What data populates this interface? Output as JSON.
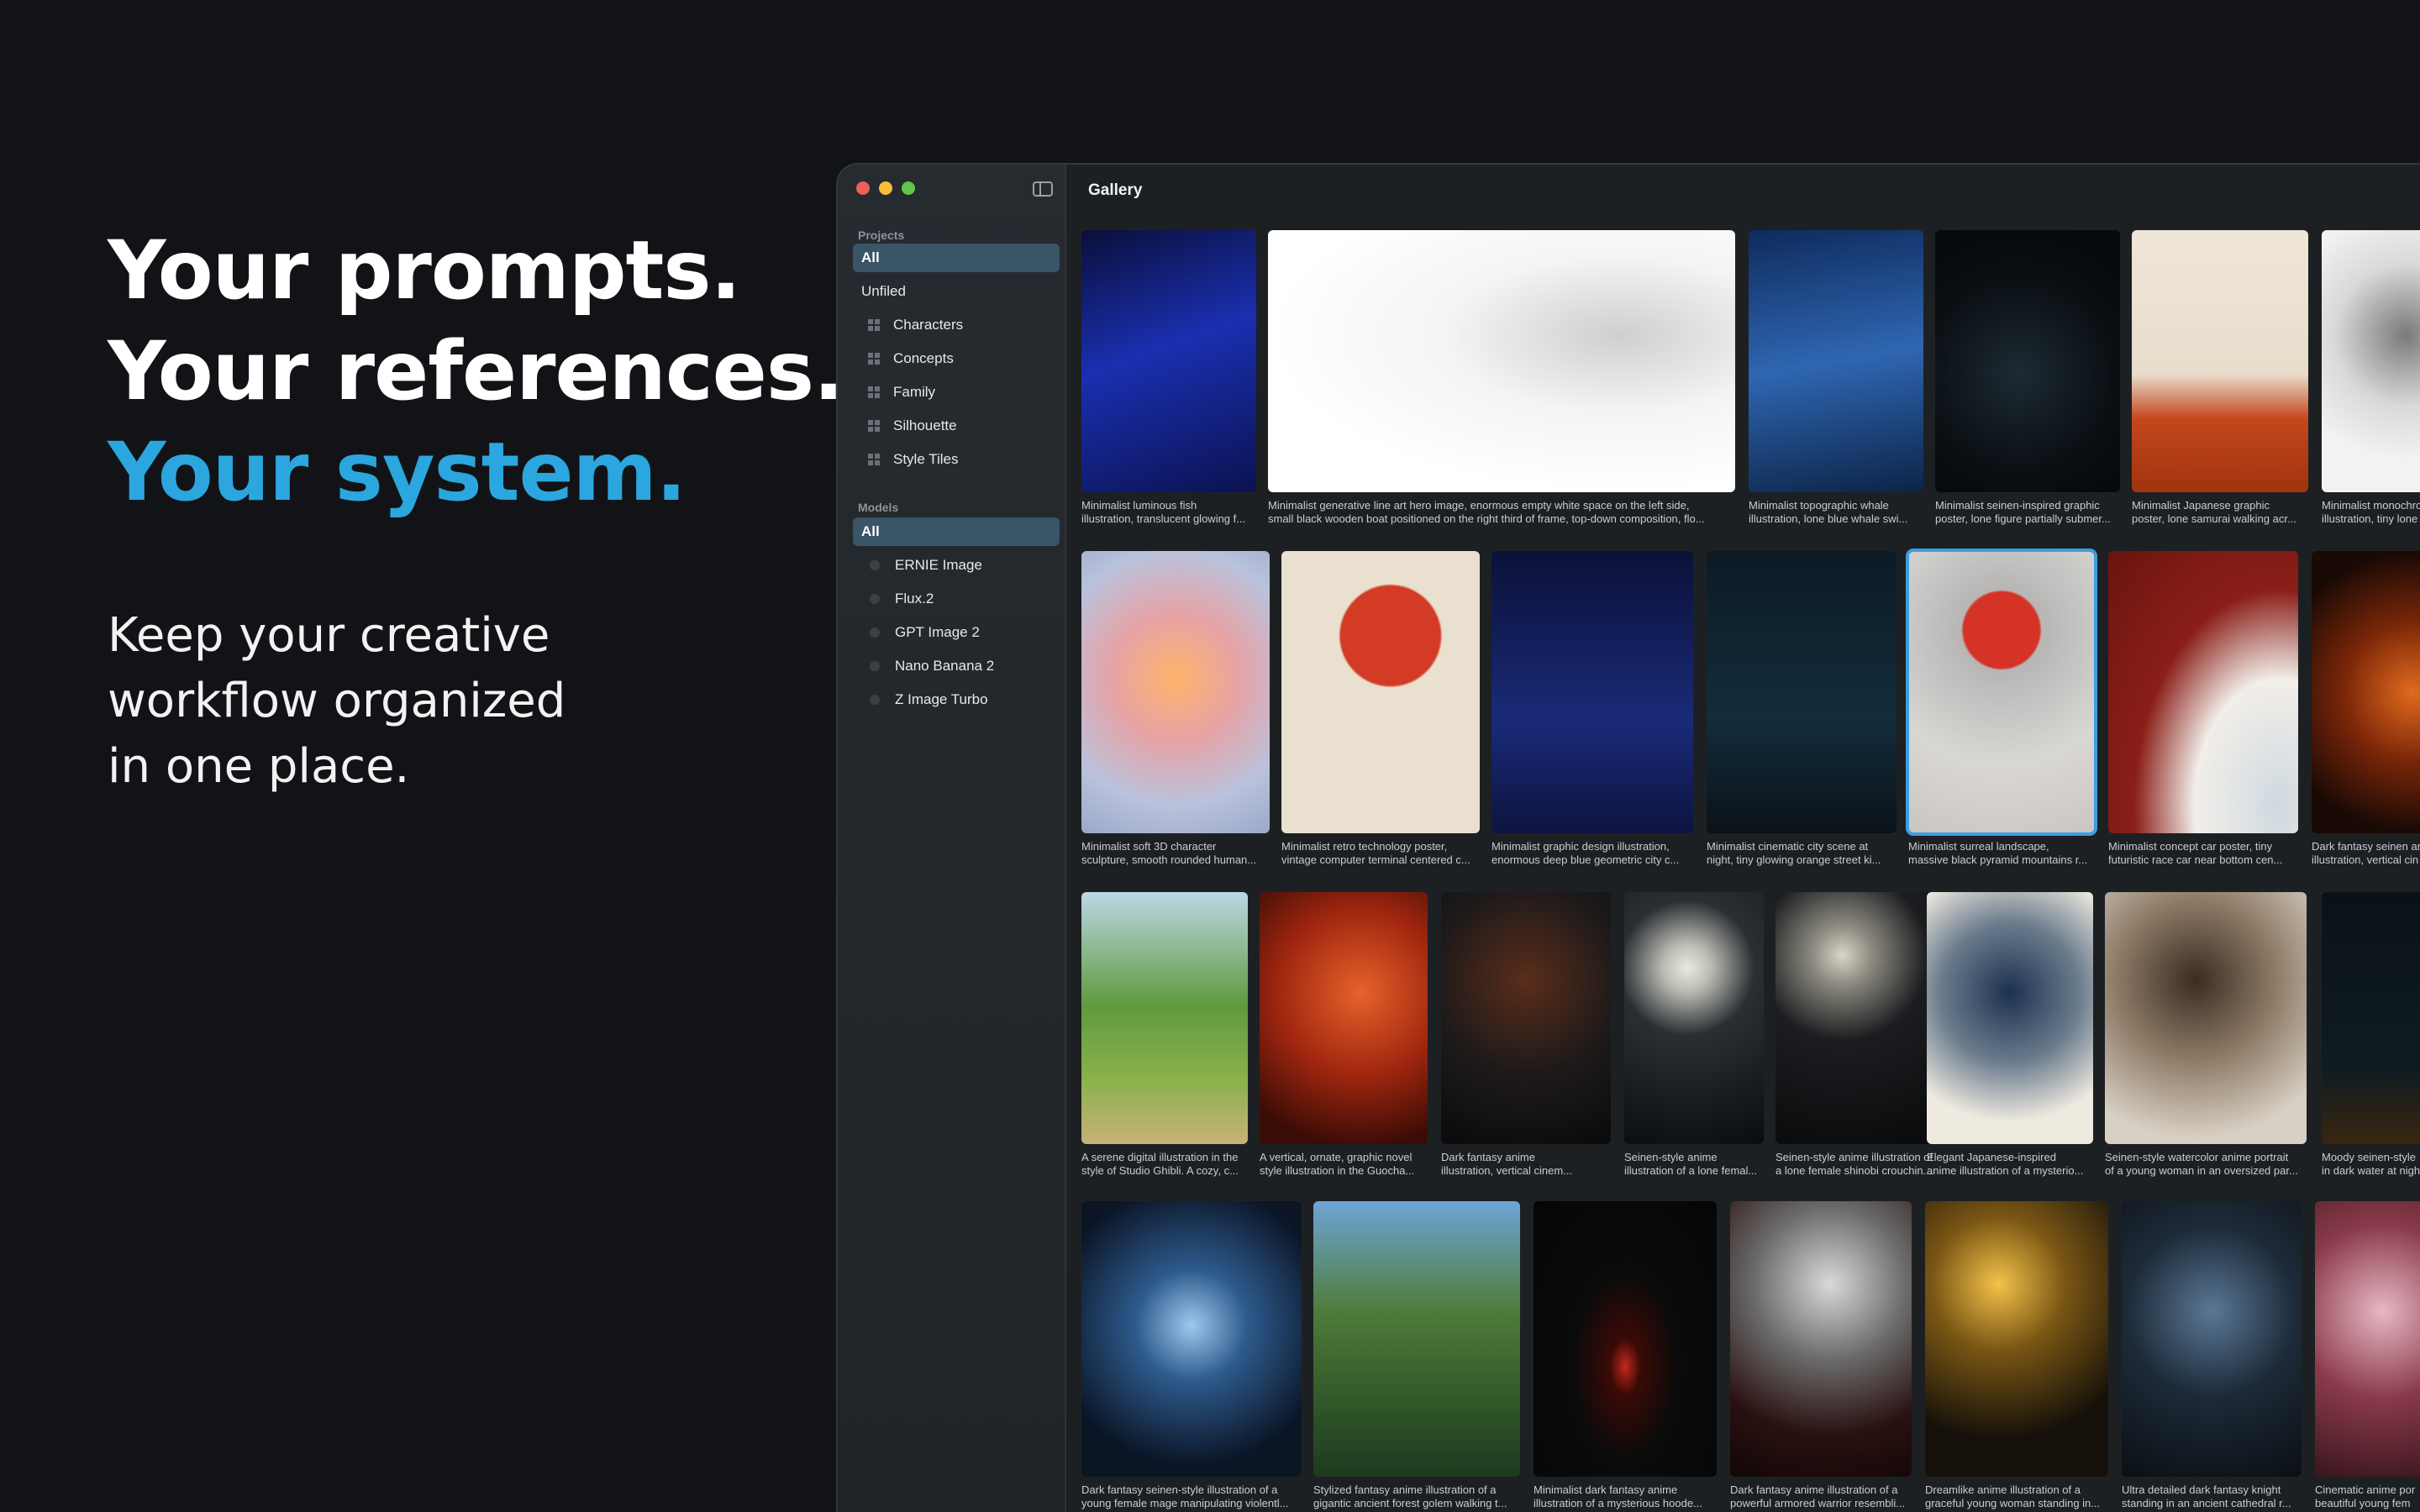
{
  "hero": {
    "line1": "Your prompts.",
    "line2": "Your references.",
    "line3": "Your system.",
    "accent_color": "#2ba6df"
  },
  "subtitle": {
    "line1": "Keep your creative",
    "line2": "workflow organized",
    "line3": "in one place."
  },
  "window": {
    "title": "Gallery",
    "sidebar_toggle_icon": "sidebar-toggle-icon"
  },
  "sidebar": {
    "projects_label": "Projects",
    "projects": [
      {
        "label": "All",
        "selected": true
      },
      {
        "label": "Unfiled"
      },
      {
        "label": "Characters",
        "icon": "grid-icon"
      },
      {
        "label": "Concepts",
        "icon": "grid-icon"
      },
      {
        "label": "Family",
        "icon": "grid-icon"
      },
      {
        "label": "Silhouette",
        "icon": "grid-icon"
      },
      {
        "label": "Style Tiles",
        "icon": "grid-icon"
      }
    ],
    "models_label": "Models",
    "models": [
      {
        "label": "All",
        "selected": true
      },
      {
        "label": "ERNIE Image"
      },
      {
        "label": "Flux.2"
      },
      {
        "label": "GPT Image 2"
      },
      {
        "label": "Nano Banana 2"
      },
      {
        "label": "Z Image Turbo"
      }
    ]
  },
  "gallery": [
    [
      {
        "l1": "Minimalist luminous fish",
        "l2": "illustration, translucent glowing f...",
        "bg": "linear-gradient(160deg,#0a0f3a,#1a2fb0 45%,#0b1250)"
      },
      {
        "l1": "Minimalist generative line art hero image, enormous empty white space on the left side,",
        "l2": "small black wooden boat positioned on the right third of frame, top-down composition, flo...",
        "bg": "radial-gradient(ellipse at 75% 40%,#cfcfcf 0%,#f4f4f4 35%,#ffffff 70%)"
      },
      {
        "l1": "Minimalist topographic whale",
        "l2": "illustration, lone blue whale swi...",
        "bg": "linear-gradient(170deg,#0e2b5c,#2f66b2 50%,#0c2447)"
      },
      {
        "l1": "Minimalist seinen-inspired graphic",
        "l2": "poster, lone figure partially submer...",
        "bg": "radial-gradient(circle at 45% 55%,#1d2a33 0%,#0a0f13 55%,#050708)"
      },
      {
        "l1": "Minimalist Japanese graphic",
        "l2": "poster, lone samurai walking acr...",
        "bg": "linear-gradient(180deg,#efe6d8 0%,#e8dccb 55%,#c4471c 72%,#a0330f)"
      },
      {
        "l1": "Minimalist monochrome",
        "l2": "illustration, tiny lone",
        "bg": "radial-gradient(circle at 50% 40%,#7a7a7a 0%,#d9d9d9 40%,#f2f2f2 70%)"
      }
    ],
    [
      {
        "l1": "Minimalist soft 3D character",
        "l2": "sculpture, smooth rounded human...",
        "bg": "radial-gradient(circle at 50% 45%,#ffb36b 0%,#e6a3a6 35%,#b9c2dc 70%,#9aa8c8)"
      },
      {
        "l1": "Minimalist retro technology poster,",
        "l2": "vintage computer terminal centered c...",
        "bg": "radial-gradient(circle at 55% 30%,#d33b24 0%,#d33b24 22%,#e9e0cf 23%,#e9e0cf 100%)"
      },
      {
        "l1": "Minimalist graphic design illustration,",
        "l2": "enormous deep blue geometric city c...",
        "bg": "linear-gradient(180deg,#0b1138,#1a2a78 60%,#0d1440)"
      },
      {
        "l1": "Minimalist cinematic city scene at",
        "l2": "night, tiny glowing orange street ki...",
        "bg": "linear-gradient(180deg,#0c1b26,#132c3b 60%,#0a1218)"
      },
      {
        "l1": "Minimalist surreal landscape,",
        "l2": "massive black pyramid mountains r...",
        "bg": "radial-gradient(circle at 50% 28%,#d63327 0%,#d63327 17%,#b8b6b5 18%,#d9d7d4 60%,#c9c6c2)",
        "selected": true
      },
      {
        "l1": "Minimalist concept car poster, tiny",
        "l2": "futuristic race car near bottom cen...",
        "bg": "radial-gradient(ellipse at 90% 90%,#cfd9e0 0%,#f2eee9 35%,#8a1e18 60%,#6a140f)"
      },
      {
        "l1": "Dark fantasy seinen an",
        "l2": "illustration, vertical cin",
        "bg": "radial-gradient(circle at 60% 50%,#e26a1e 0%,#7a2608 40%,#1a0a05 80%)"
      }
    ],
    [
      {
        "l1": "A serene digital illustration in the",
        "l2": "style of Studio Ghibli. A cozy, c...",
        "bg": "linear-gradient(180deg,#bcd7e6 0%,#5f9a3e 45%,#8bb24c 75%,#c7b27a)"
      },
      {
        "l1": "A vertical, ornate, graphic novel",
        "l2": "style illustration in the Guocha...",
        "bg": "radial-gradient(circle at 60% 40%,#e6632a 0%,#a1260f 45%,#3a0c06 85%)"
      },
      {
        "l1": "Dark fantasy anime",
        "l2": "illustration, vertical cinem...",
        "bg": "radial-gradient(circle at 50% 35%,#5a2d1a 0%,#1e1a1a 50%,#0a0a0a)"
      },
      {
        "l1": "Seinen-style anime",
        "l2": "illustration of a lone femal...",
        "bg": "radial-gradient(circle at 45% 30%,#e9e9e0 0%,#bdbdb5 12%,#2a2f33 35%,#0a0c0e)"
      },
      {
        "l1": "Seinen-style anime illustration of",
        "l2": "a lone female shinobi crouchin...",
        "bg": "radial-gradient(circle at 40% 25%,#d9d5c6 0%,#8c8a80 14%,#1b1d20 40%,#08090a)"
      },
      {
        "l1": "Elegant Japanese-inspired",
        "l2": "anime illustration of a mysterio...",
        "bg": "radial-gradient(circle at 50% 40%,#1c3150 0%,#6a7b8c 40%,#efeae0 75%)"
      },
      {
        "l1": "Seinen-style watercolor anime portrait",
        "l2": "of a young woman in an oversized par...",
        "bg": "radial-gradient(circle at 45% 35%,#3a2c22 0%,#8d7a66 40%,#d8d0c4 80%)"
      },
      {
        "l1": "Moody seinen-style",
        "l2": "in dark water at nigh",
        "bg": "linear-gradient(180deg,#0a1216,#0e1c22 70%,#3a2510)"
      }
    ],
    [
      {
        "l1": "Dark fantasy seinen-style illustration of a",
        "l2": "young female mage manipulating violentl...",
        "bg": "radial-gradient(circle at 50% 45%,#9fc8ee 0%,#2d5a8c 30%,#0b1526 75%)"
      },
      {
        "l1": "Stylized fantasy anime illustration of a",
        "l2": "gigantic ancient forest golem walking t...",
        "bg": "linear-gradient(180deg,#6ea4d6 0%,#4f7c3a 40%,#2f5528 75%,#1e3a1f)"
      },
      {
        "l1": "Minimalist dark fantasy anime",
        "l2": "illustration of a mysterious hoode...",
        "bg": "radial-gradient(ellipse at 50% 60%,#c2281a 0%,#3a0a06 12%,#0b0b0b 40%,#050505)"
      },
      {
        "l1": "Dark fantasy anime illustration of a",
        "l2": "powerful armored warrior resembli...",
        "bg": "radial-gradient(circle at 55% 30%,#d9d9d9 0%,#6b6b6b 35%,#2a1010 70%,#120707)"
      },
      {
        "l1": "Dreamlike anime illustration of a",
        "l2": "graceful young woman standing in...",
        "bg": "radial-gradient(circle at 40% 30%,#f3c24a 0%,#7a5614 30%,#15110a 70%)"
      },
      {
        "l1": "Ultra detailed dark fantasy knight",
        "l2": "standing in an ancient cathedral r...",
        "bg": "radial-gradient(circle at 50% 40%,#5a7896 0%,#1d2a38 45%,#0a0f14)"
      },
      {
        "l1": "Cinematic anime por",
        "l2": "beautiful young fem",
        "bg": "radial-gradient(circle at 40% 40%,#e7b8c4 0%,#8a3a4a 45%,#2a0f16)"
      }
    ]
  ]
}
